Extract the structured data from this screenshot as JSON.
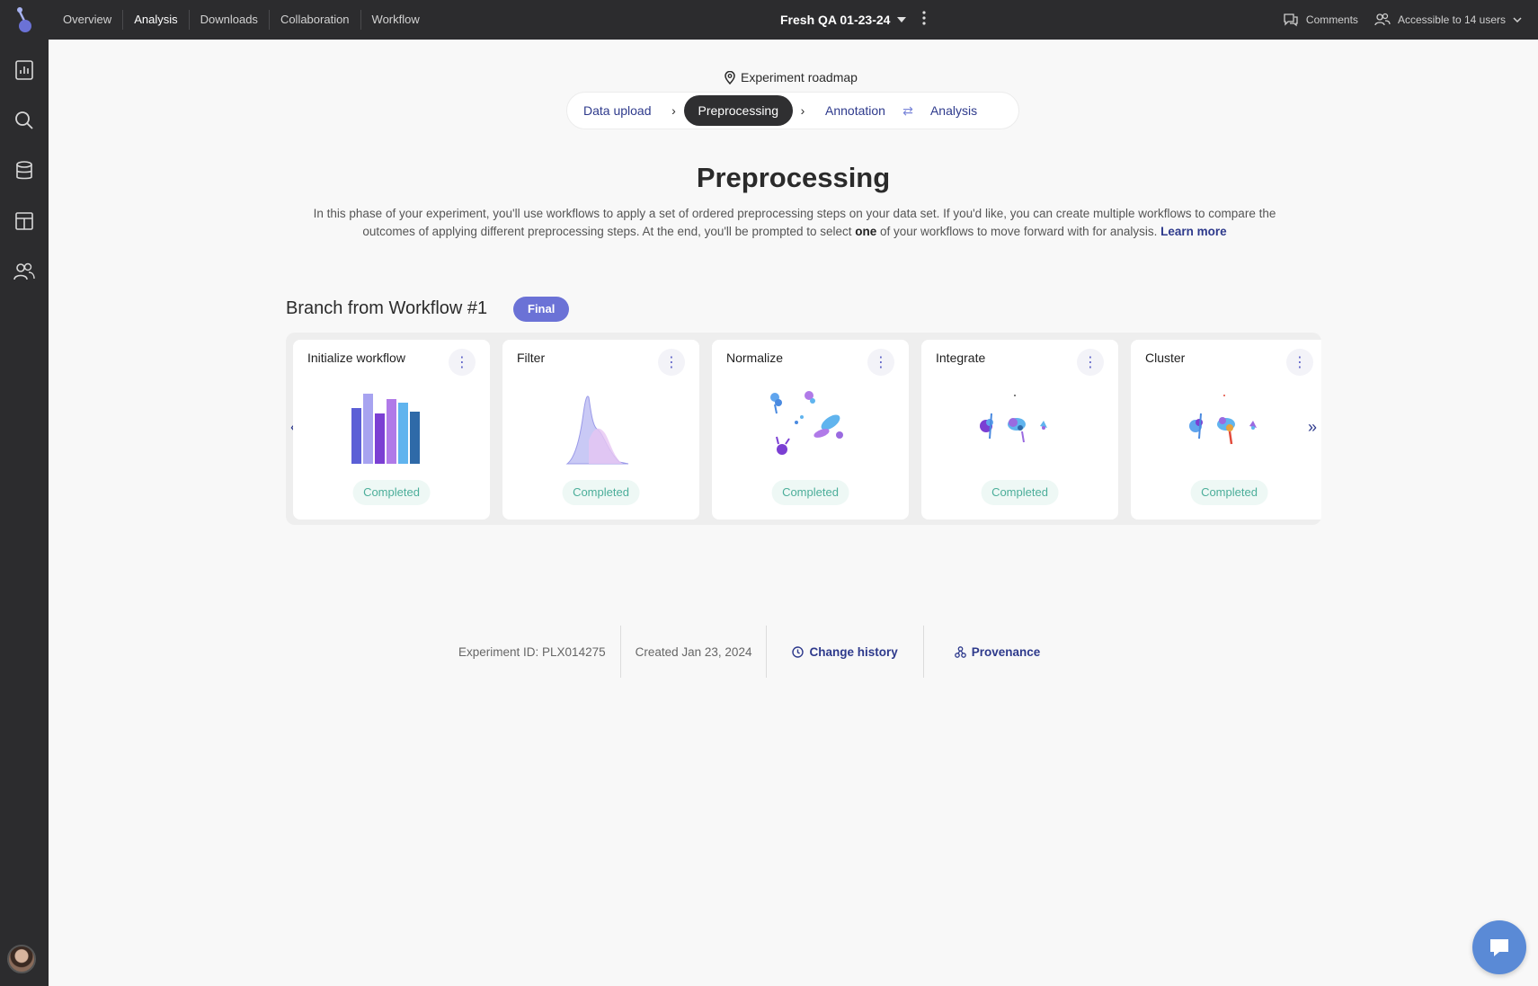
{
  "topbar": {
    "nav": [
      "Overview",
      "Analysis",
      "Downloads",
      "Collaboration",
      "Workflow"
    ],
    "active_nav": "Analysis",
    "experiment_name": "Fresh QA 01-23-24",
    "comments_label": "Comments",
    "access_label": "Accessible to 14 users"
  },
  "sidebar": {
    "icons": [
      "report-icon",
      "search-icon",
      "database-icon",
      "layout-icon",
      "users-icon"
    ]
  },
  "roadmap": {
    "label": "Experiment roadmap",
    "steps": [
      "Data upload",
      "Preprocessing",
      "Annotation",
      "Analysis"
    ],
    "active_step": "Preprocessing"
  },
  "page": {
    "title": "Preprocessing",
    "desc_part1": "In this phase of your experiment, you'll use workflows to apply a set of ordered preprocessing steps on your data set. If you'd like, you can create multiple workflows to compare the outcomes of applying different preprocessing steps. At the end, you'll be prompted to select ",
    "desc_bold": "one",
    "desc_part2": " of your workflows to move forward with for analysis. ",
    "learn_more": "Learn more"
  },
  "branch": {
    "title": "Branch from Workflow #1",
    "badge": "Final",
    "cards": [
      {
        "title": "Initialize workflow",
        "status": "Completed"
      },
      {
        "title": "Filter",
        "status": "Completed"
      },
      {
        "title": "Normalize",
        "status": "Completed"
      },
      {
        "title": "Integrate",
        "status": "Completed"
      },
      {
        "title": "Cluster",
        "status": "Completed"
      }
    ]
  },
  "footer": {
    "experiment_id": "Experiment ID: PLX014275",
    "created": "Created Jan 23, 2024",
    "change_history": "Change history",
    "provenance": "Provenance"
  },
  "colors": {
    "accent": "#6b72d6",
    "link": "#2e3a8c",
    "status_green": "#4cae9a",
    "dark_bg": "#2c2c2e"
  }
}
